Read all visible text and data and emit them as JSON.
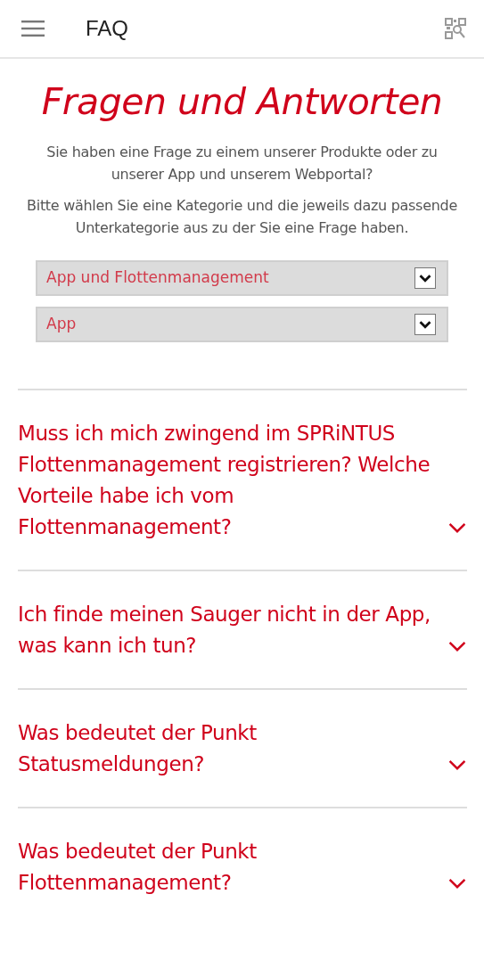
{
  "header": {
    "title": "FAQ"
  },
  "heading": "Fragen und Antworten",
  "intro": [
    "Sie haben eine Frage zu einem unserer Produkte oder zu unserer App und unserem Webportal?",
    "Bitte wählen Sie eine Kategorie und die jeweils dazu passende Unterkategorie aus zu der Sie eine Frage haben."
  ],
  "selects": [
    {
      "value": "App und Flottenmanagement"
    },
    {
      "value": "App"
    }
  ],
  "questions": [
    {
      "text": "Muss ich mich zwingend im SPRiNTUS Flottenmanagement registrieren? Welche Vorteile habe ich vom Flottenmanagement?",
      "expanded": false
    },
    {
      "text": "Ich finde meinen Sauger nicht in der App, was kann ich tun?",
      "expanded": false
    },
    {
      "text": "Was bedeutet der Punkt Statusmeldungen?",
      "expanded": false
    },
    {
      "text": "Was bedeutet der Punkt Flottenmanagement?",
      "expanded": false
    }
  ]
}
